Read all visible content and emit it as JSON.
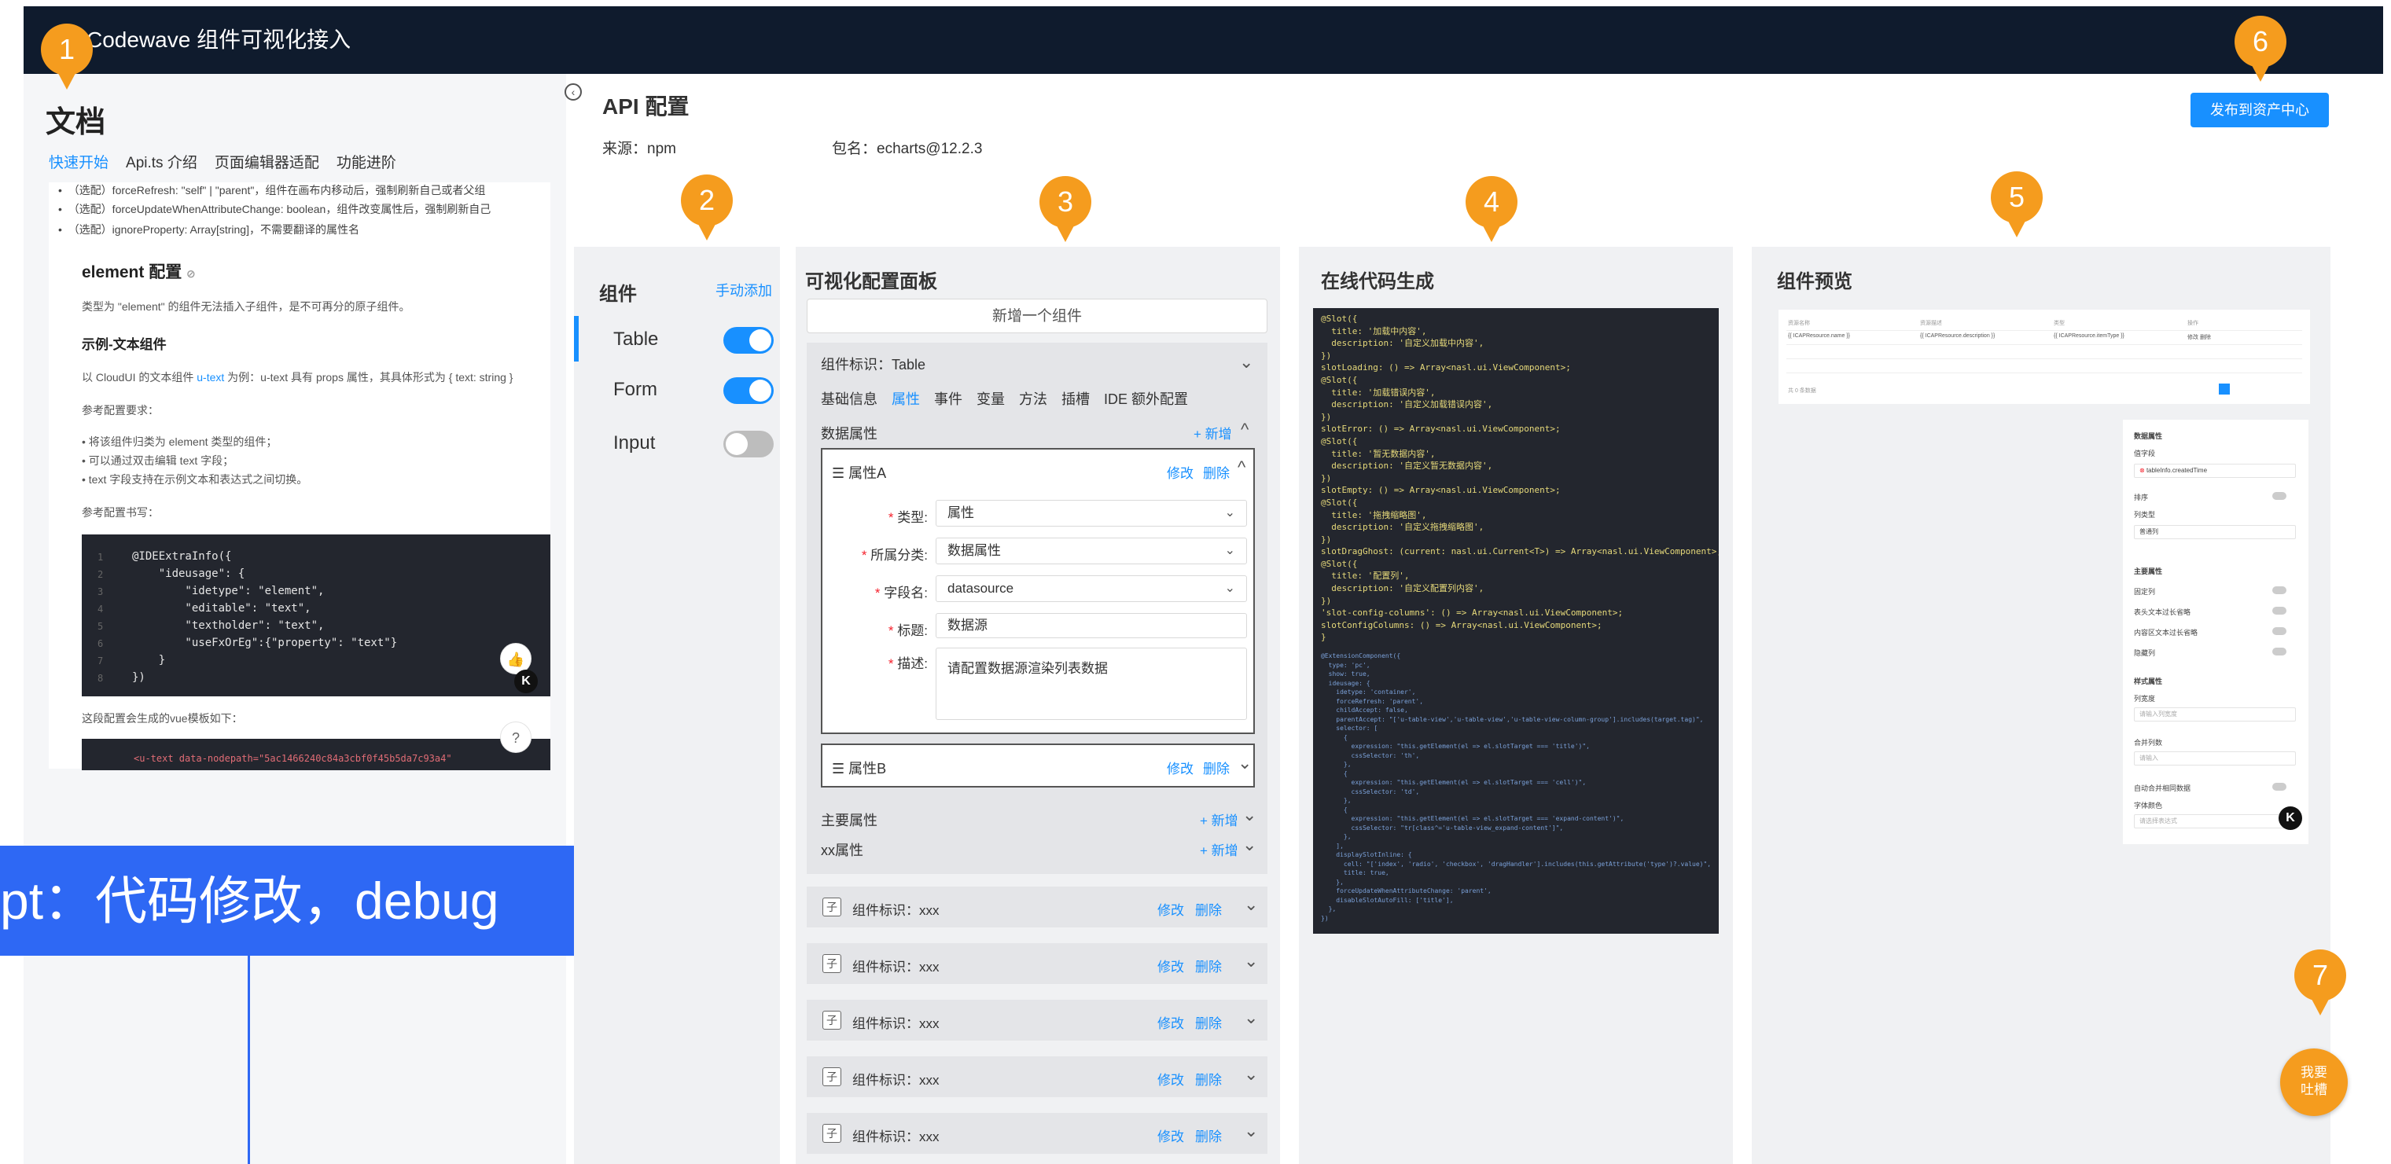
{
  "app": {
    "title": "Codewave 组件可视化接入"
  },
  "docs": {
    "title": "文档",
    "tabs": [
      {
        "label": "快速开始",
        "active": true
      },
      {
        "label": "Api.ts 介绍",
        "active": false
      },
      {
        "label": "页面编辑器适配",
        "active": false
      },
      {
        "label": "功能进阶",
        "active": false
      }
    ],
    "bullets_top": [
      "（选配）forceRefresh: \"self\" | \"parent\"，组件在画布内移动后，强制刷新自己或者父组",
      "（选配）forceUpdateWhenAttributeChange: boolean，组件改变属性后，强制刷新自己",
      "（选配）ignoreProperty: Array[string]，不需要翻译的属性名"
    ],
    "element_heading": "element 配置",
    "element_desc": "类型为 \"element\" 的组件无法插入子组件，是不可再分的原子组件。",
    "example_heading": "示例-文本组件",
    "example_desc_pre": "以 CloudUI 的文本组件 ",
    "example_desc_link": "u-text",
    "example_desc_post": " 为例：u-text 具有 props 属性，其具体形式为 { text: string }",
    "req_heading": "参考配置要求：",
    "req_items": [
      "将该组件归类为 element 类型的组件；",
      "可以通过双击编辑 text 字段；",
      "text 字段支持在示例文本和表达式之间切换。"
    ],
    "code_heading": "参考配置书写：",
    "code_lines": [
      "@IDEExtraInfo({",
      "    \"ideusage\": {",
      "        \"idetype\": \"element\",",
      "        \"editable\": \"text\",",
      "        \"textholder\": \"text\",",
      "        \"useFxOrEg\":{\"property\": \"text\"}",
      "    }",
      "})"
    ],
    "vue_desc": "这段配置会生成的vue模板如下：",
    "vue_line": "<u-text data-nodepath=\"5ac1466240c84a3cbf0f45b5da7c93a4\"",
    "banner_text": "pt：代码修改，debug"
  },
  "api": {
    "title": "API 配置",
    "source_label": "来源：npm",
    "package_label": "包名：echarts@12.2.3",
    "publish_button": "发布到资产中心"
  },
  "components_panel": {
    "title": "组件",
    "add_label": "手动添加",
    "items": [
      {
        "label": "Table",
        "enabled": true
      },
      {
        "label": "Form",
        "enabled": true
      },
      {
        "label": "Input",
        "enabled": false
      }
    ]
  },
  "config_panel": {
    "title": "可视化配置面板",
    "new_component_button": "新增一个组件",
    "component_id": "组件标识：Table",
    "tabs": [
      {
        "label": "基础信息",
        "active": false
      },
      {
        "label": "属性",
        "active": true
      },
      {
        "label": "事件",
        "active": false
      },
      {
        "label": "变量",
        "active": false
      },
      {
        "label": "方法",
        "active": false
      },
      {
        "label": "插槽",
        "active": false
      },
      {
        "label": "IDE 额外配置",
        "active": false
      }
    ],
    "data_props_label": "数据属性",
    "add_label": "+ 新增",
    "edit_label": "修改",
    "delete_label": "删除",
    "attr_a": {
      "name": "属性A",
      "fields": {
        "type_label": "类型:",
        "type_value": "属性",
        "category_label": "所属分类:",
        "category_value": "数据属性",
        "field_label": "字段名:",
        "field_value": "datasource",
        "title_label": "标题:",
        "title_value": "数据源",
        "desc_label": "描述:",
        "desc_value": "请配置数据源渲染列表数据"
      }
    },
    "attr_b": {
      "name": "属性B"
    },
    "main_props_label": "主要属性",
    "xx_props_label": "xx属性",
    "collapsed_components": [
      {
        "tag": "子",
        "label": "组件标识：xxx"
      },
      {
        "tag": "子",
        "label": "组件标识：xxx"
      },
      {
        "tag": "子",
        "label": "组件标识：xxx"
      },
      {
        "tag": "子",
        "label": "组件标识：xxx"
      },
      {
        "tag": "子",
        "label": "组件标识：xxx"
      }
    ]
  },
  "code_panel": {
    "title": "在线代码生成",
    "code_top": "@Slot({\n  title: '加载中内容',\n  description: '自定义加载中内容',\n})\nslotLoading: () => Array<nasl.ui.ViewComponent>;\n@Slot({\n  title: '加载错误内容',\n  description: '自定义加载错误内容',\n})\nslotError: () => Array<nasl.ui.ViewComponent>;\n@Slot({\n  title: '暂无数据内容',\n  description: '自定义暂无数据内容',\n})\nslotEmpty: () => Array<nasl.ui.ViewComponent>;\n@Slot({\n  title: '拖拽缩略图',\n  description: '自定义拖拽缩略图',\n})\nslotDragGhost: (current: nasl.ui.Current<T>) => Array<nasl.ui.ViewComponent>;\n@Slot({\n  title: '配置列',\n  description: '自定义配置列内容',\n})\n'slot-config-columns': () => Array<nasl.ui.ViewComponent>;\nslotConfigColumns: () => Array<nasl.ui.ViewComponent>;\n}",
    "code_bottom": "@ExtensionComponent({\n  type: 'pc',\n  show: true,\n  ideusage: {\n    idetype: 'container',\n    forceRefresh: 'parent',\n    childAccept: false,\n    parentAccept: \"['u-table-view','u-table-view','u-table-view-column-group'].includes(target.tag)\",\n    selector: [\n      {\n        expression: \"this.getElement(el => el.slotTarget === 'title')\",\n        cssSelector: 'th',\n      },\n      {\n        expression: \"this.getElement(el => el.slotTarget === 'cell')\",\n        cssSelector: 'td',\n      },\n      {\n        expression: \"this.getElement(el => el.slotTarget === 'expand-content')\",\n        cssSelector: \"tr[class^='u-table-view_expand-content']\",\n      },\n    ],\n    displaySlotInline: {\n      cell: \"['index', 'radio', 'checkbox', 'dragHandler'].includes(this.getAttribute('type')?.value)\",\n      title: true,\n    },\n    forceUpdateWhenAttributeChange: 'parent',\n    disableSlotAutoFill: ['title'],\n  },\n})"
  },
  "preview_panel": {
    "title": "组件预览",
    "table_headers": [
      "资源名称",
      "资源描述",
      "类型",
      "操作"
    ],
    "table_cells": [
      "{{ ICAPResource.name }}",
      "{{ ICAPResource.description }}",
      "{{ ICAPResource.itemType }}",
      "修改 删除"
    ],
    "pager_label": "共 0 条数据",
    "props": {
      "data_section": "数据属性",
      "value_field_label": "值字段",
      "value_field_value": "tableInfo.createdTime",
      "sort_label": "排序",
      "column_type_label": "列类型",
      "column_type_value": "普通列",
      "main_section": "主要属性",
      "fixed_label": "固定列",
      "header_ellipsis_label": "表头文本过长省略",
      "content_ellipsis_label": "内容区文本过长省略",
      "hidden_label": "隐藏列",
      "style_section": "样式属性",
      "width_label": "列宽度",
      "width_placeholder": "请输入列宽度",
      "merge_label": "合并列数",
      "merge_placeholder": "请输入",
      "auto_merge_label": "自动合并相同数据",
      "font_color_label": "字体颜色",
      "font_color_placeholder": "请选择表达式"
    }
  },
  "markers": [
    "1",
    "2",
    "3",
    "4",
    "5",
    "6",
    "7"
  ],
  "feedback": {
    "line1": "我要",
    "line2": "吐槽"
  },
  "colors": {
    "accent": "#1890ff",
    "marker": "#f59c1e",
    "topbar": "#0f1b2d",
    "banner": "#2e68f4"
  }
}
